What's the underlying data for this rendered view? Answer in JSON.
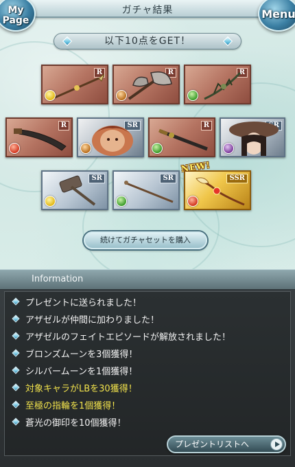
{
  "header": {
    "title": "ガチャ結果",
    "mypage_label_1": "My",
    "mypage_label_2": "Page",
    "menu_label": "Menu"
  },
  "banner": {
    "text": "以下10点をGET！"
  },
  "cards": [
    {
      "rarity": "R",
      "element": "light",
      "item": "spear"
    },
    {
      "rarity": "R",
      "element": "earth",
      "item": "axe"
    },
    {
      "rarity": "R",
      "element": "wind",
      "item": "bow"
    },
    {
      "rarity": "R",
      "element": "fire",
      "item": "sword"
    },
    {
      "rarity": "SR",
      "element": "earth",
      "item": "summon-character"
    },
    {
      "rarity": "R",
      "element": "wind",
      "item": "katana"
    },
    {
      "rarity": "SR",
      "element": "dark",
      "item": "character"
    },
    {
      "rarity": "SR",
      "element": "light",
      "item": "hammer"
    },
    {
      "rarity": "SR",
      "element": "wind",
      "item": "staff"
    },
    {
      "rarity": "SSR",
      "element": "fire",
      "item": "scepter"
    }
  ],
  "new_badge": "NEW!",
  "buy_button": {
    "label": "続けてガチャセットを購入"
  },
  "information": {
    "title": "Information",
    "items": [
      {
        "text": "プレゼントに送られました！",
        "highlight": false
      },
      {
        "text": "アザゼルが仲間に加わりました！",
        "highlight": false
      },
      {
        "text": "アザゼルのフェイトエピソードが解放されました！",
        "highlight": false
      },
      {
        "text": "ブロンズムーンを3個獲得！",
        "highlight": false
      },
      {
        "text": "シルバームーンを1個獲得！",
        "highlight": false
      },
      {
        "text": "対象キャラがLBを30獲得！",
        "highlight": true
      },
      {
        "text": "至極の指輪を1個獲得！",
        "highlight": true
      },
      {
        "text": "蒼光の御印を10個獲得！",
        "highlight": false
      }
    ]
  },
  "present_button": {
    "label": "プレゼントリストへ"
  },
  "colors": {
    "highlight_text": "#f2e34c",
    "normal_text": "#f2f2f2",
    "rare_r": "#b57462",
    "rare_sr": "#b7c5d2",
    "rare_ssr": "#f0c64a"
  }
}
